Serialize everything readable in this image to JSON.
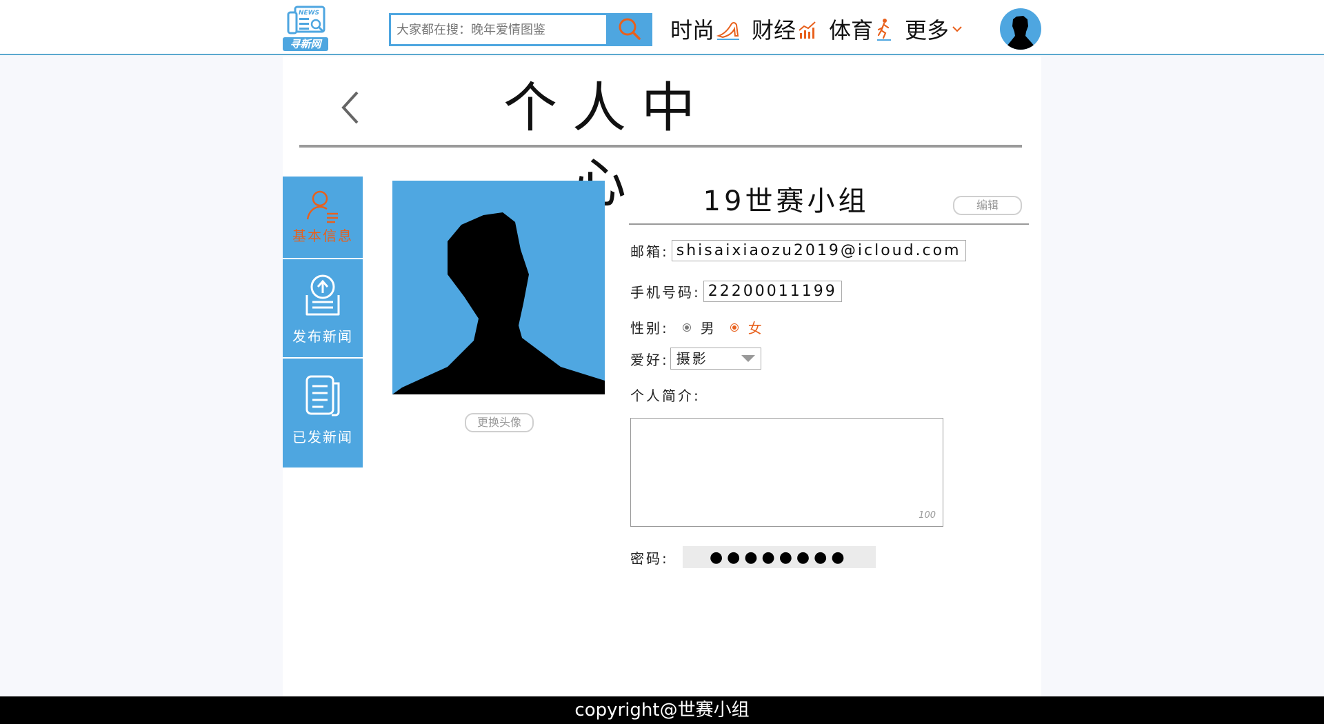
{
  "header": {
    "logo_badge": "NEWS",
    "logo_text": "寻新网",
    "search_placeholder": "大家都在搜：晚年爱情图鉴",
    "nav": [
      {
        "label": "时尚",
        "icon": "high-heel-icon"
      },
      {
        "label": "财经",
        "icon": "growth-chart-icon"
      },
      {
        "label": "体育",
        "icon": "runner-icon"
      },
      {
        "label": "更多",
        "icon": "chevron-down-icon"
      }
    ]
  },
  "page": {
    "title": "个人中心"
  },
  "sidebar": {
    "items": [
      {
        "label": "基本信息",
        "icon": "user-info-icon",
        "active": true
      },
      {
        "label": "发布新闻",
        "icon": "upload-news-icon",
        "active": false
      },
      {
        "label": "已发新闻",
        "icon": "published-news-icon",
        "active": false
      }
    ]
  },
  "profile": {
    "change_photo_label": "更换头像",
    "username": "19世赛小组",
    "edit_label": "编辑",
    "email_label": "邮箱:",
    "email": "shisaixiaozu2019@icloud.com",
    "phone_label": "手机号码:",
    "phone": "22200011199",
    "gender_label": "性别:",
    "gender_options": [
      "男",
      "女"
    ],
    "gender_selected": "女",
    "hobby_label": "爱好:",
    "hobby": "摄影",
    "bio_label": "个人简介:",
    "bio_counter": "100",
    "password_label": "密码:",
    "password_mask": "●●●●●●●●"
  },
  "footer": {
    "copyright": "copyright@世赛小组"
  },
  "colors": {
    "accent_blue": "#4ea6e0",
    "accent_orange": "#e8601c",
    "header_rule": "#5ba8cf"
  }
}
